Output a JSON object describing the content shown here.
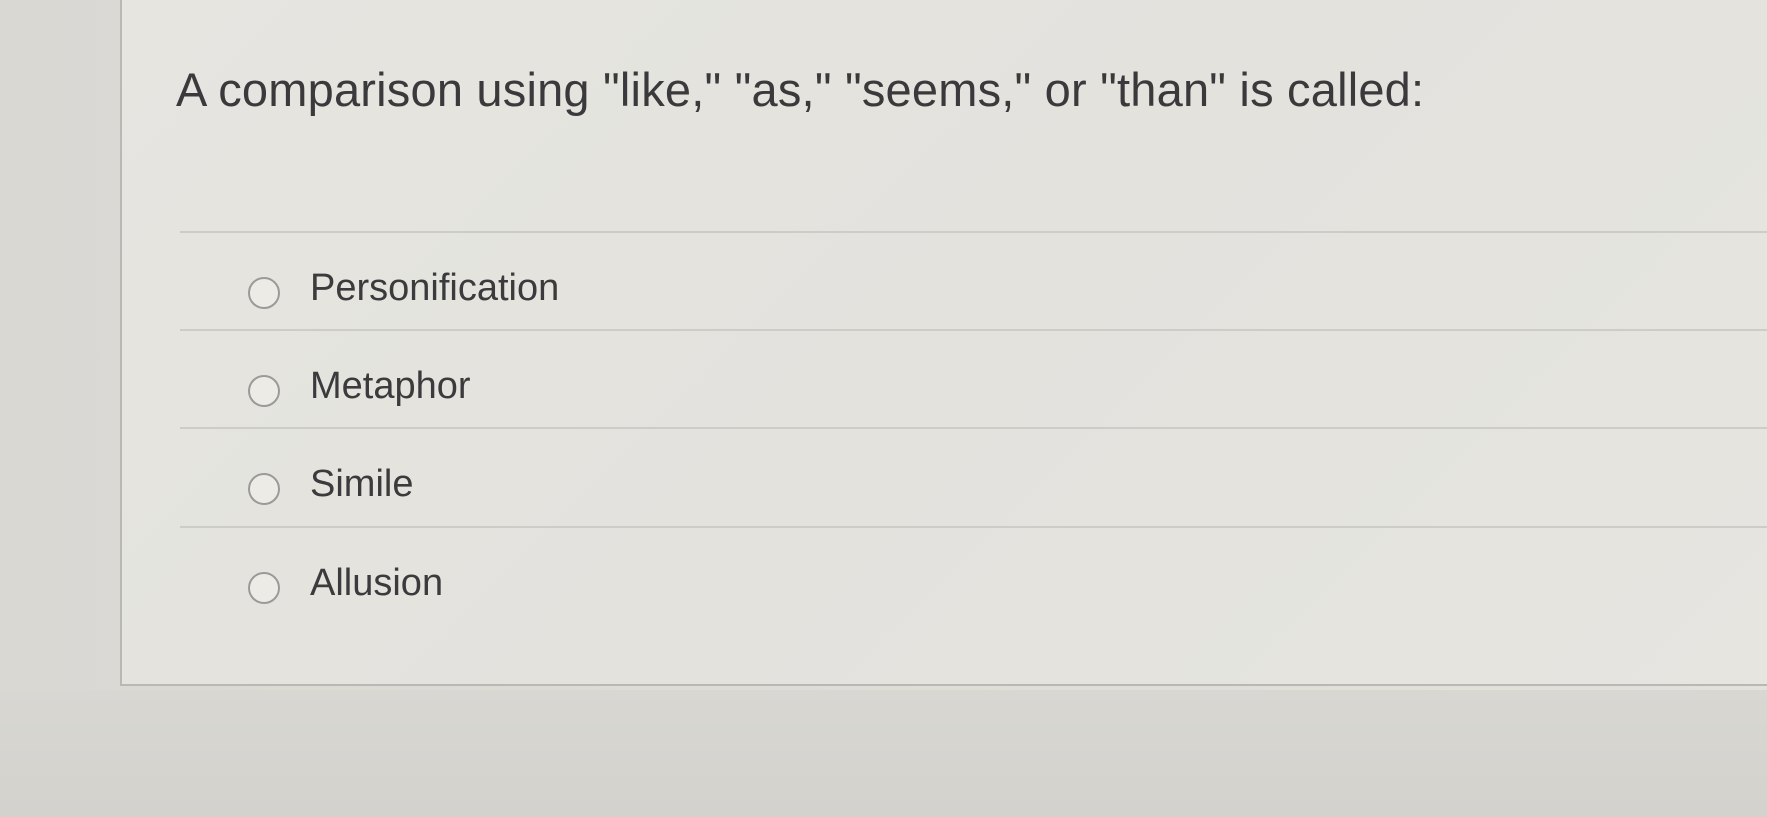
{
  "question": {
    "text": "A comparison using \"like,\" \"as,\" \"seems,\" or \"than\" is called:"
  },
  "answers": [
    {
      "label": "Personification",
      "selected": false
    },
    {
      "label": "Metaphor",
      "selected": false
    },
    {
      "label": "Simile",
      "selected": false
    },
    {
      "label": "Allusion",
      "selected": false
    }
  ]
}
